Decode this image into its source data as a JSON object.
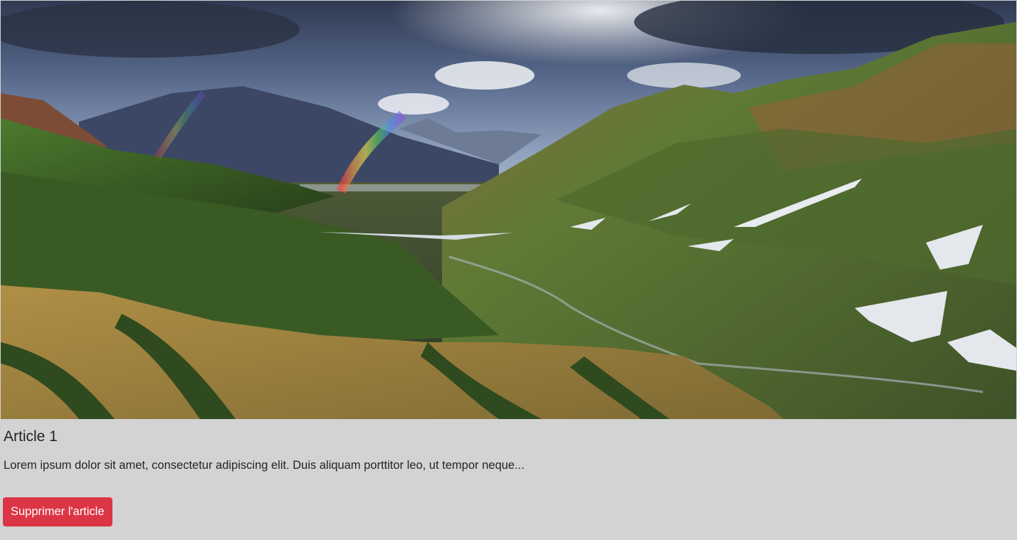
{
  "article": {
    "image": {
      "subject": "mountain-valley-rainbow-landscape"
    },
    "title": "Article 1",
    "excerpt": "Lorem ipsum dolor sit amet, consectetur adipiscing elit. Duis aliquam porttitor leo, ut tempor neque...",
    "delete_button_label": "Supprimer l'article"
  },
  "colors": {
    "card_background": "#d3d3d3",
    "danger": "#dc3545",
    "text": "#212529"
  }
}
